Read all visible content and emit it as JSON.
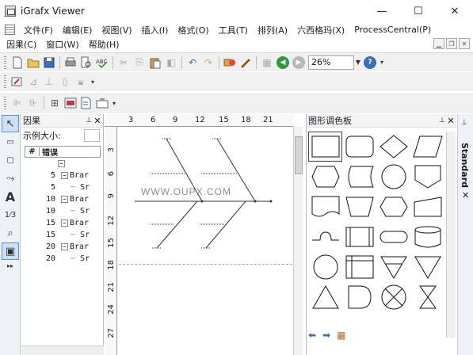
{
  "window": {
    "title": "iGrafx Viewer",
    "controls": [
      "—",
      "☐",
      "✕"
    ]
  },
  "menubar_primary": [
    "文件(F)",
    "编辑(E)",
    "视图(V)",
    "插入(I)",
    "格式(O)",
    "工具(T)",
    "排列(A)",
    "六西格玛(X)",
    "ProcessCentral(P)"
  ],
  "menubar_secondary": [
    "因果(C)",
    "窗口(W)",
    "帮助(H)"
  ],
  "toolbar": {
    "zoom_value": "26%"
  },
  "cause_panel": {
    "title": "因果",
    "sample_size_label": "示例大小:",
    "column_num": "#",
    "column_error": "错误",
    "rows": [
      {
        "num": "",
        "label": "",
        "level": 0
      },
      {
        "num": "5",
        "label": "Brar",
        "level": 1
      },
      {
        "num": "5",
        "label": "Sr",
        "level": 2
      },
      {
        "num": "10",
        "label": "Brar",
        "level": 1
      },
      {
        "num": "10",
        "label": "Sr",
        "level": 2
      },
      {
        "num": "15",
        "label": "Brar",
        "level": 1
      },
      {
        "num": "15",
        "label": "Sr",
        "level": 2
      },
      {
        "num": "20",
        "label": "Brar",
        "level": 1
      },
      {
        "num": "20",
        "label": "Sr",
        "level": 2
      }
    ]
  },
  "rulers": {
    "horizontal": [
      "3",
      "6",
      "9",
      "12",
      "15",
      "18",
      "21"
    ],
    "vertical": [
      "3",
      "6",
      "9",
      "12",
      "15",
      "18",
      "21",
      "24",
      "27"
    ]
  },
  "canvas": {
    "watermark": "WWW.OUPX.COM"
  },
  "shape_palette": {
    "title": "图形调色板",
    "tab_label": "Standard",
    "shapes": [
      [
        "rectangle",
        "rounded-rectangle",
        "diamond",
        "parallelogram"
      ],
      [
        "preparation",
        "stored-data",
        "circle",
        "offpage-connector"
      ],
      [
        "document",
        "manual-operation",
        "hexagon",
        "manual-input"
      ],
      [
        "junction",
        "predefined-process",
        "terminator",
        "database"
      ],
      [
        "connector",
        "internal-storage",
        "merge-triangle",
        "extract-triangle"
      ],
      [
        "triangle",
        "delay",
        "summing-junction",
        "collate"
      ]
    ]
  }
}
